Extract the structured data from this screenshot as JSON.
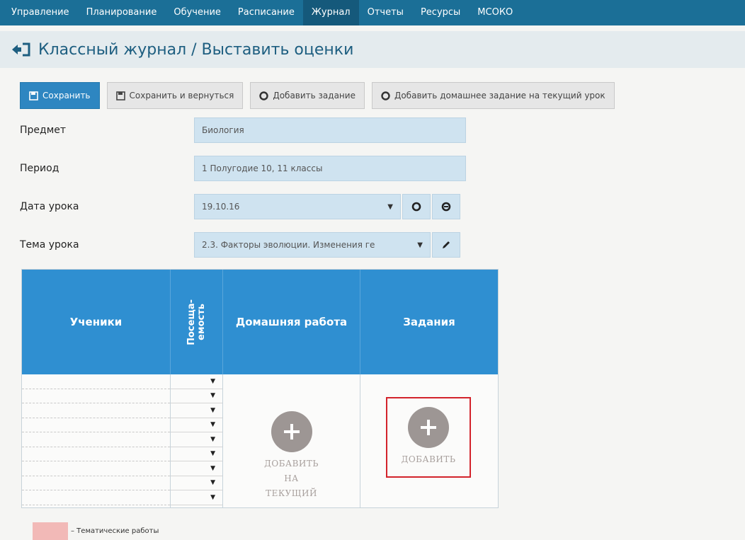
{
  "nav": {
    "items": [
      {
        "label": "Управление"
      },
      {
        "label": "Планирование"
      },
      {
        "label": "Обучение"
      },
      {
        "label": "Расписание"
      },
      {
        "label": "Журнал"
      },
      {
        "label": "Отчеты"
      },
      {
        "label": "Ресурсы"
      },
      {
        "label": "МСОКО"
      }
    ],
    "active": "Журнал"
  },
  "page": {
    "title": "Классный журнал / Выставить оценки"
  },
  "toolbar": {
    "save": "Сохранить",
    "save_return": "Сохранить и вернуться",
    "add_task": "Добавить задание",
    "add_homework": "Добавить домашнее задание на текущий урок"
  },
  "form": {
    "subject_label": "Предмет",
    "subject_value": "Биология",
    "period_label": "Период",
    "period_value": "1 Полугодие 10, 11 классы",
    "date_label": "Дата урока",
    "date_value": "19.10.16",
    "topic_label": "Тема урока",
    "topic_value": "2.3. Факторы эволюции. Изменения ге"
  },
  "journal": {
    "col_students": "Ученики",
    "col_attendance": "Посеща-\nемость",
    "col_homework": "Домашняя работа",
    "col_tasks": "Задания",
    "rows": 9,
    "homework_add": {
      "line1": "ДОБАВИТЬ",
      "line2": "НА",
      "line3": "ТЕКУЩИЙ"
    },
    "tasks_add": "ДОБАВИТЬ"
  },
  "legend": {
    "text": "– Тематические работы",
    "color": "#f2b9b7"
  },
  "colors": {
    "nav_bg": "#1b6f97",
    "header_blue": "#2f8fd1",
    "primary_button": "#2e86c1",
    "highlight": "#d3232b"
  },
  "icons": [
    "back-arrow-icon",
    "save-icon",
    "plus-circle-icon",
    "pencil-icon",
    "dropdown-caret-icon"
  ]
}
